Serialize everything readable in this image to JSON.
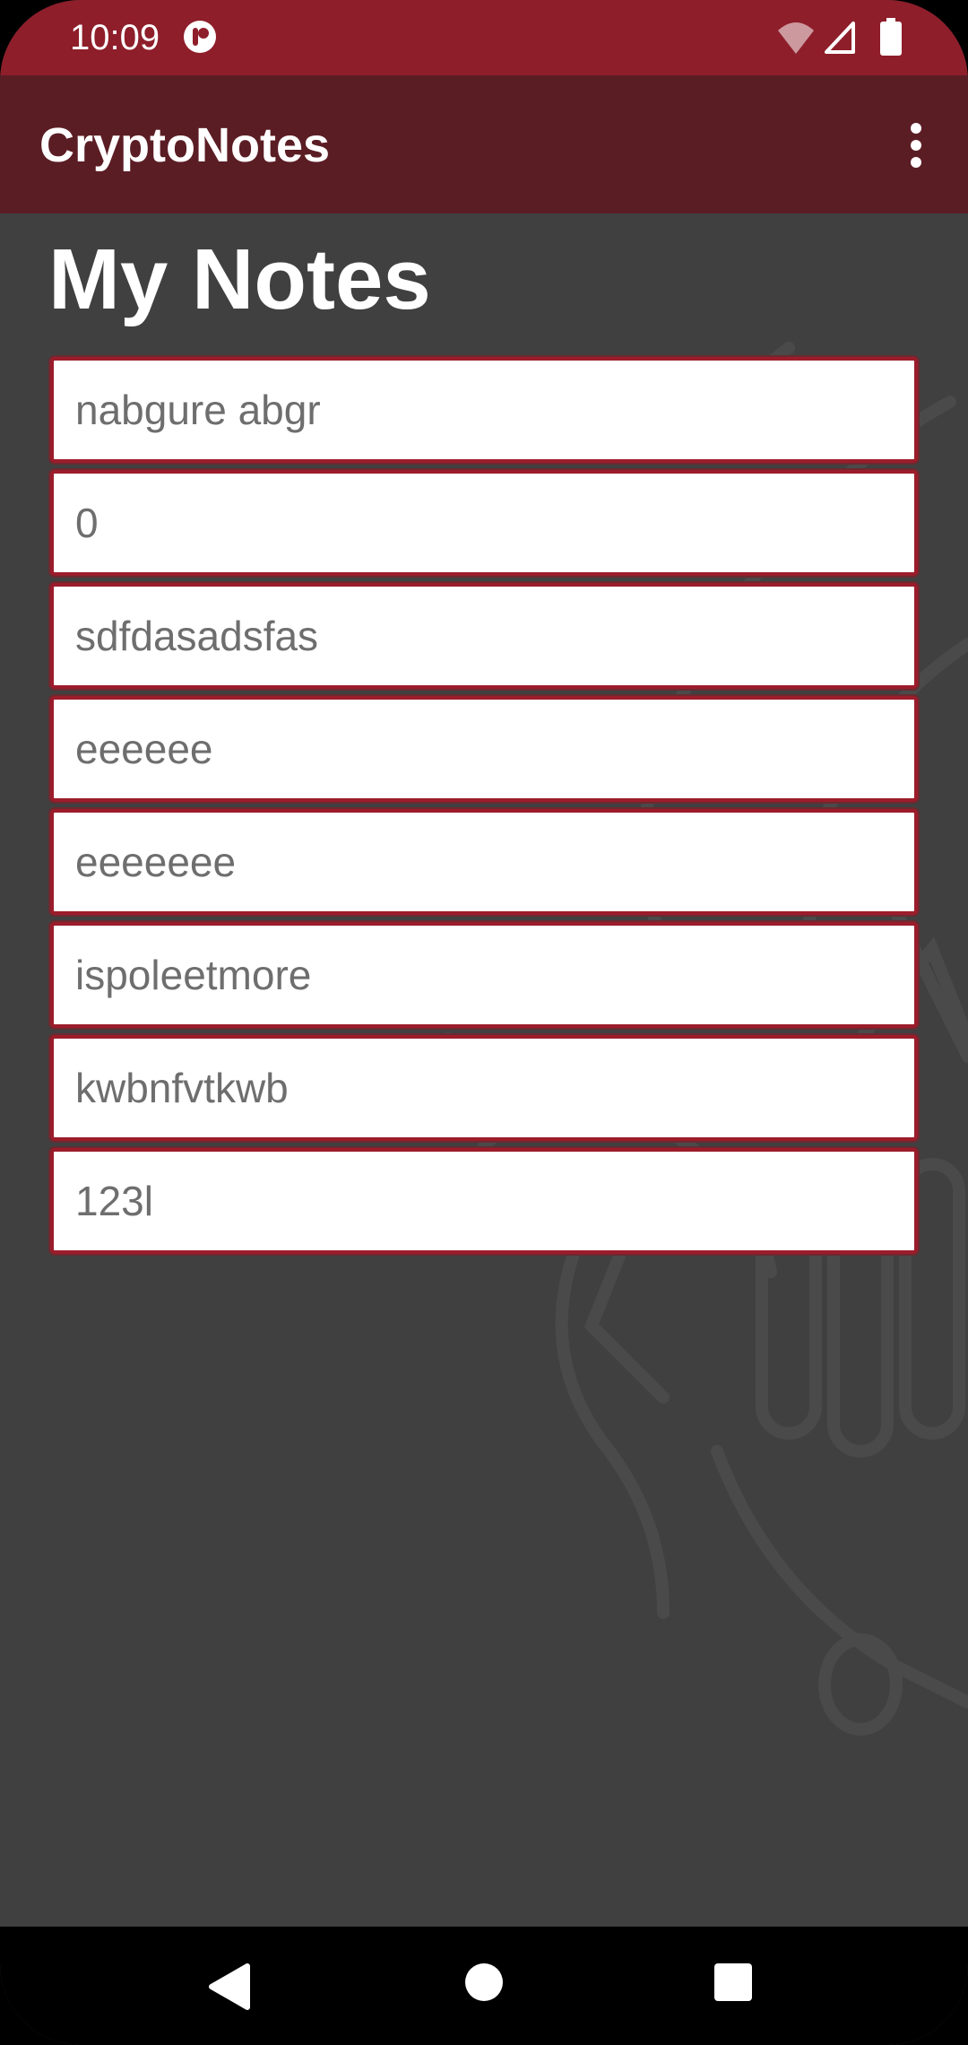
{
  "status_bar": {
    "time": "10:09",
    "icons": [
      "app-notification-icon",
      "wifi-icon",
      "cell-signal-icon",
      "battery-icon"
    ]
  },
  "app_bar": {
    "title": "CryptoNotes",
    "menu_icon": "more-vert-icon"
  },
  "page": {
    "title": "My Notes"
  },
  "notes": [
    {
      "title": "nabgure abgr"
    },
    {
      "title": "0"
    },
    {
      "title": "sdfdasadsfas"
    },
    {
      "title": "eeeeee"
    },
    {
      "title": "eeeeeee"
    },
    {
      "title": "ispoleetmore"
    },
    {
      "title": "kwbnfvtkwb"
    },
    {
      "title": "123l"
    }
  ],
  "nav_bar": {
    "icons": [
      "back-icon",
      "home-icon",
      "recents-icon"
    ]
  },
  "colors": {
    "status_bar": "#8e1e2a",
    "app_bar": "#5b1d24",
    "background": "#404040",
    "note_border": "#9c1c2b",
    "note_text": "#6e6e6e"
  }
}
